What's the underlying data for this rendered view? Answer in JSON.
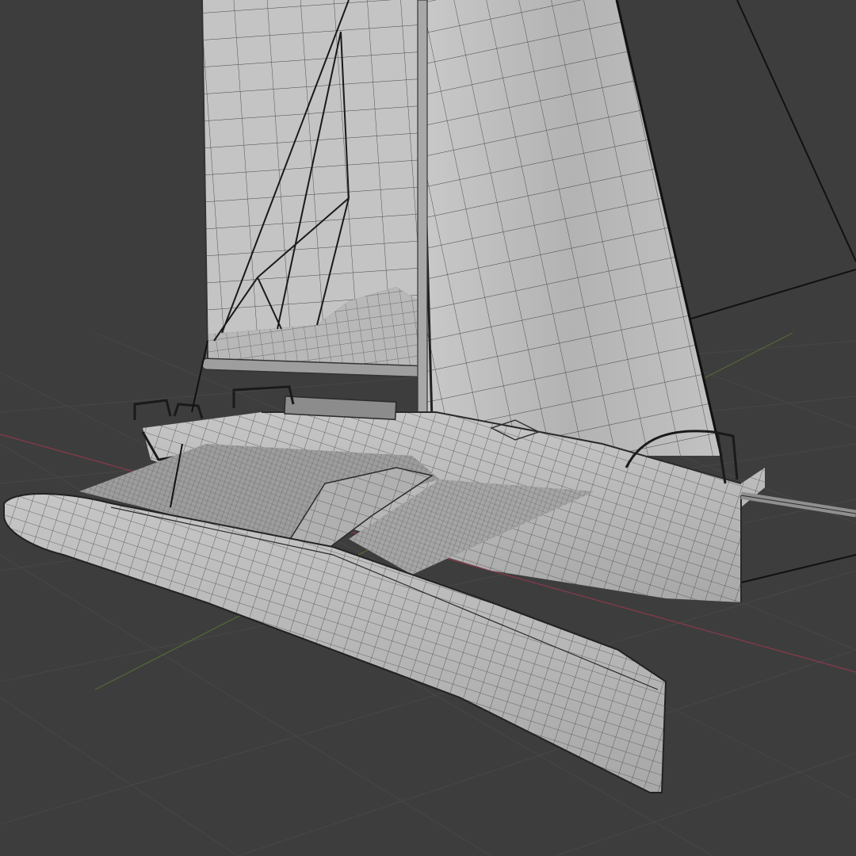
{
  "viewport": {
    "background": "#3d3d3d",
    "grid_color": "#4a4a4a",
    "x_axis_color": "#8a3a4a",
    "y_axis_color": "#5e7a36",
    "model_fill": "#bfbfbf",
    "model_shade": "#9a9a9a",
    "wire_color": "#2a2a2a",
    "rigging_color": "#111111"
  },
  "model": {
    "kind": "trimaran-sailboat-wireframe",
    "parts": [
      "mainsail",
      "jib",
      "boom",
      "main-hull",
      "outrigger-float",
      "trampoline-net",
      "crossbeam",
      "bowsprit",
      "railing",
      "rigging"
    ]
  }
}
